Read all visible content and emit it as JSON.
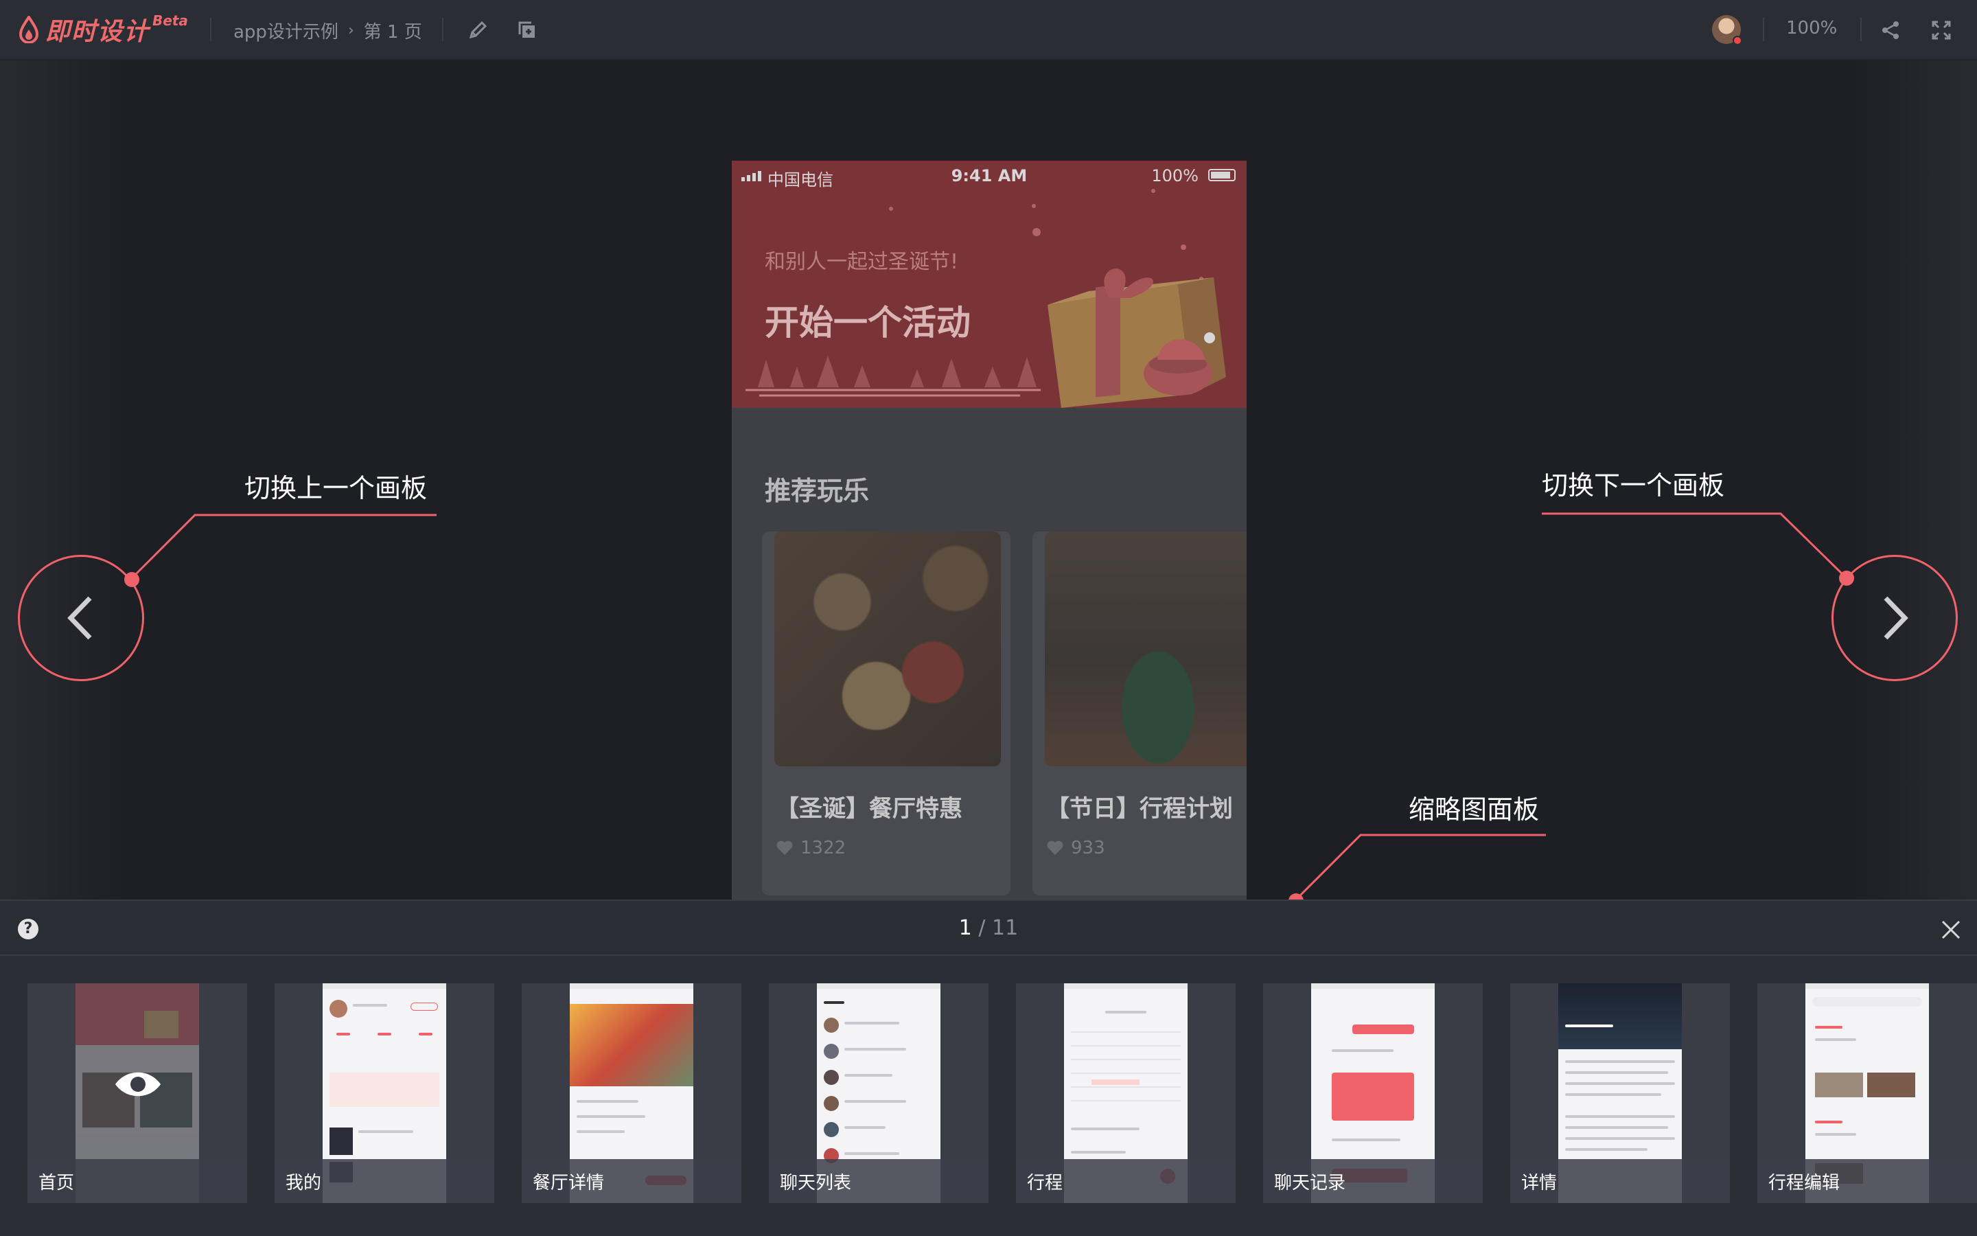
{
  "app": {
    "name": "即时设计",
    "badge": "Beta",
    "brand_color": "#ef6a6c"
  },
  "breadcrumb": {
    "project": "app设计示例",
    "page": "第 1 页"
  },
  "toolbar": {
    "edit_icon": "pencil-icon",
    "copy_icon": "duplicate-icon",
    "zoom": "100%",
    "share_icon": "share-icon",
    "fullscreen_icon": "fullscreen-icon"
  },
  "phone": {
    "status": {
      "carrier": "中国电信",
      "time": "9:41 AM",
      "battery": "100%"
    },
    "hero": {
      "subtitle": "和别人一起过圣诞节!",
      "title": "开始一个活动"
    },
    "section_title": "推荐玩乐",
    "cards": [
      {
        "title": "【圣诞】餐厅特惠",
        "likes": "1322",
        "badge_icon": "dish-icon"
      },
      {
        "title": "【节日】行程计划",
        "likes": "933",
        "badge_icon": "train-icon"
      }
    ]
  },
  "annotations": {
    "prev": "切换上一个画板",
    "next": "切换下一个画板",
    "panel": "缩略图面板",
    "accent": "#f0626a"
  },
  "panel": {
    "help": "?",
    "current": "1",
    "separator": "/",
    "total": "11",
    "thumbnails": [
      {
        "label": "首页"
      },
      {
        "label": "我的"
      },
      {
        "label": "餐厅详情"
      },
      {
        "label": "聊天列表"
      },
      {
        "label": "行程"
      },
      {
        "label": "聊天记录"
      },
      {
        "label": "详情"
      },
      {
        "label": "行程编辑"
      }
    ]
  }
}
